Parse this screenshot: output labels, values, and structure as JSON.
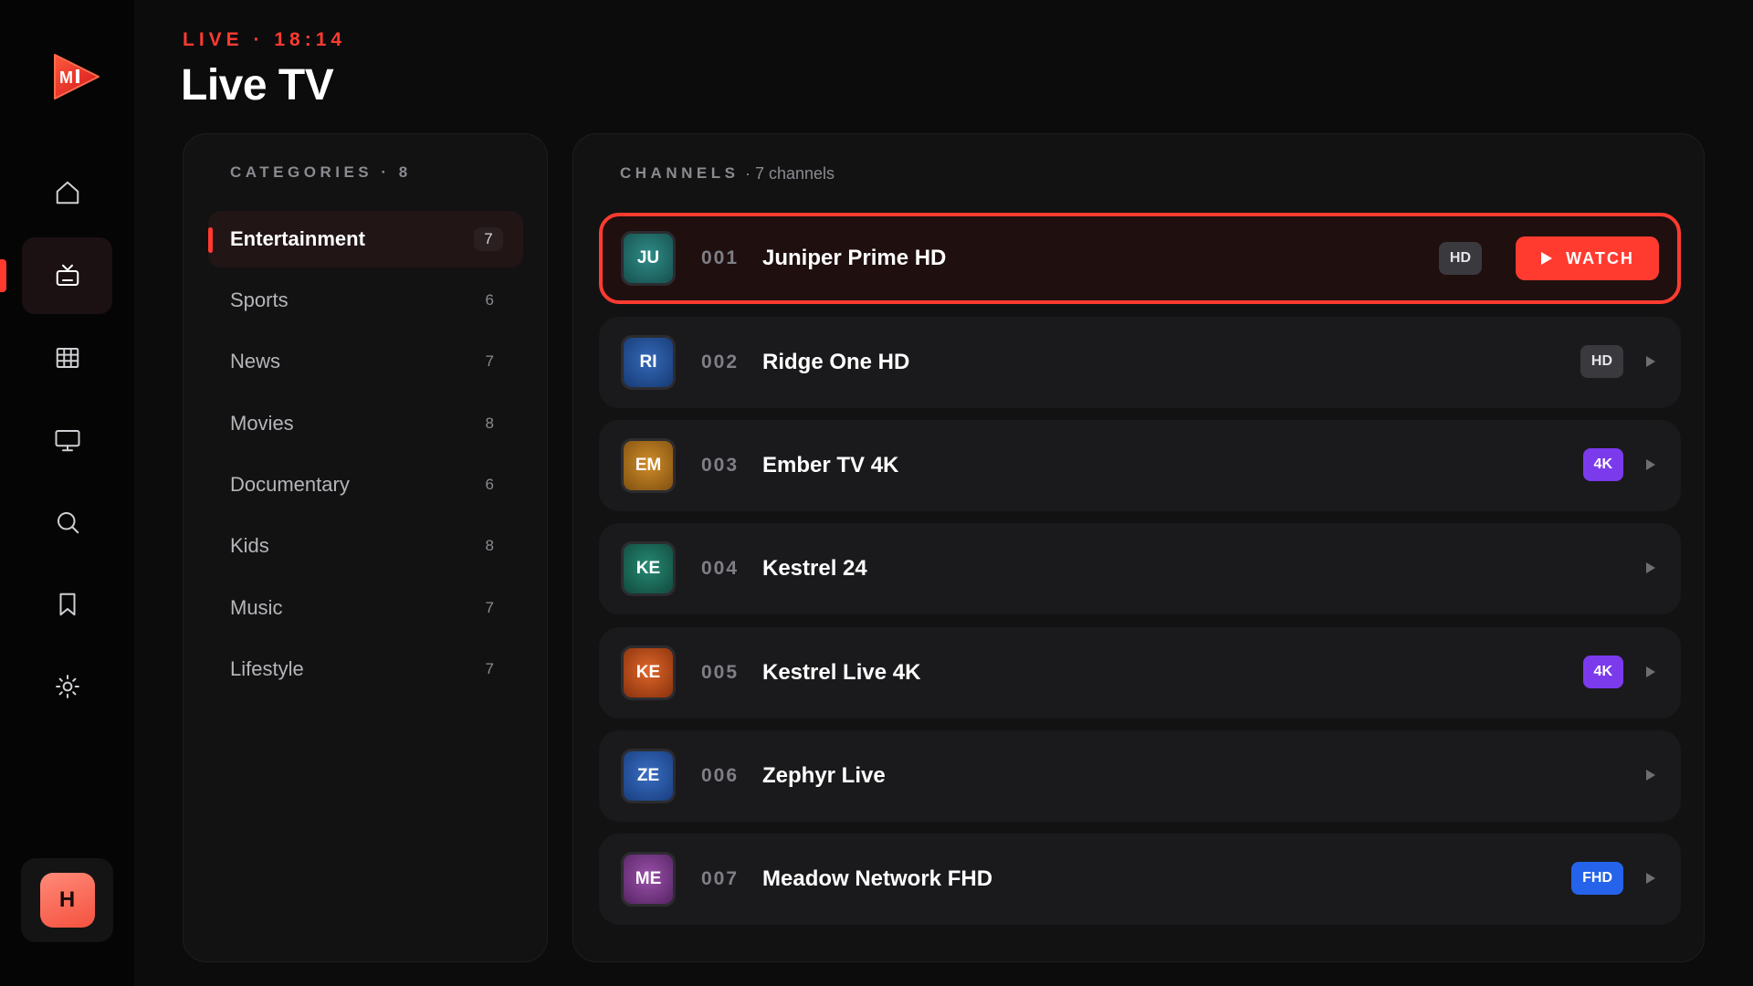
{
  "header": {
    "live_label": "LIVE · 18:14",
    "title": "Live TV"
  },
  "sidebar": {
    "items": [
      {
        "name": "home-icon",
        "active": false
      },
      {
        "name": "tv-icon",
        "active": true
      },
      {
        "name": "grid-icon",
        "active": false
      },
      {
        "name": "monitor-icon",
        "active": false
      },
      {
        "name": "search-icon",
        "active": false
      },
      {
        "name": "bookmark-icon",
        "active": false
      },
      {
        "name": "settings-icon",
        "active": false
      }
    ],
    "user_initial": "H"
  },
  "categories": {
    "heading": "CATEGORIES · 8",
    "items": [
      {
        "label": "Entertainment",
        "count": "7",
        "active": true
      },
      {
        "label": "Sports",
        "count": "6"
      },
      {
        "label": "News",
        "count": "7"
      },
      {
        "label": "Movies",
        "count": "8"
      },
      {
        "label": "Documentary",
        "count": "6"
      },
      {
        "label": "Kids",
        "count": "8"
      },
      {
        "label": "Music",
        "count": "7"
      },
      {
        "label": "Lifestyle",
        "count": "7"
      }
    ]
  },
  "channels": {
    "heading": "CHANNELS",
    "subheading": "· 7 channels",
    "watch_label": "WATCH",
    "items": [
      {
        "initials": "JU",
        "number": "001",
        "name": "Juniper Prime HD",
        "badge": "HD",
        "color": "#1f6f6c",
        "active": true
      },
      {
        "initials": "RI",
        "number": "002",
        "name": "Ridge One HD",
        "badge": "HD",
        "color": "#1f4f93"
      },
      {
        "initials": "EM",
        "number": "003",
        "name": "Ember TV 4K",
        "badge": "4K",
        "color": "#b7761a"
      },
      {
        "initials": "KE",
        "number": "004",
        "name": "Kestrel 24",
        "badge": "",
        "color": "#1b6e5c"
      },
      {
        "initials": "KE",
        "number": "005",
        "name": "Kestrel Live 4K",
        "badge": "4K",
        "color": "#c24e15"
      },
      {
        "initials": "ZE",
        "number": "006",
        "name": "Zephyr Live",
        "badge": "",
        "color": "#2b5aa8"
      },
      {
        "initials": "ME",
        "number": "007",
        "name": "Meadow Network FHD",
        "badge": "FHD",
        "color": "#7e3f8d"
      }
    ]
  },
  "colors": {
    "accent": "#ff3b30",
    "badge_4k": "#7c3aed",
    "badge_fhd": "#2563eb",
    "badge_hd": "#3a3a3e"
  }
}
